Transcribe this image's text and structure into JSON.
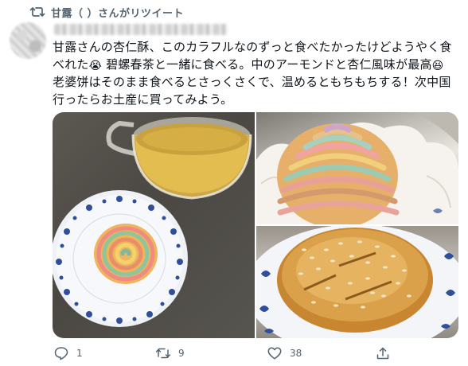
{
  "retweet_banner": {
    "icon": "retweet-icon",
    "text": "甘露（  ）さんがリツイート"
  },
  "tweet": {
    "lines": [
      "甘露さんの杏仁酥、このカラフルなのずっと食べたかったけどようやく食",
      "べれた",
      " 碧螺春茶と一緒に食べる。中のアーモンドと杏仁風味が最高",
      "老婆饼はそのまま食べるとさっくさくで、温めるともちもちする！次中国",
      "行ったらお土産に買ってみよう。"
    ],
    "emojis": [
      "😭",
      "😆"
    ]
  },
  "media": {
    "images": [
      {
        "alt": "tea-cup-and-swirl-pastry-on-plate"
      },
      {
        "alt": "rainbow-swirl-pastry-in-paper-cup"
      },
      {
        "alt": "sesame-topped-wife-cake"
      }
    ]
  },
  "actions": {
    "reply": {
      "icon": "reply-icon",
      "count": "1"
    },
    "retweet": {
      "icon": "retweet-icon",
      "count": "9"
    },
    "like": {
      "icon": "heart-icon",
      "count": "38"
    },
    "share": {
      "icon": "share-icon"
    }
  },
  "colors": {
    "muted": "#536471",
    "text": "#0f1419",
    "accent_blue": "#1d3f8f"
  }
}
